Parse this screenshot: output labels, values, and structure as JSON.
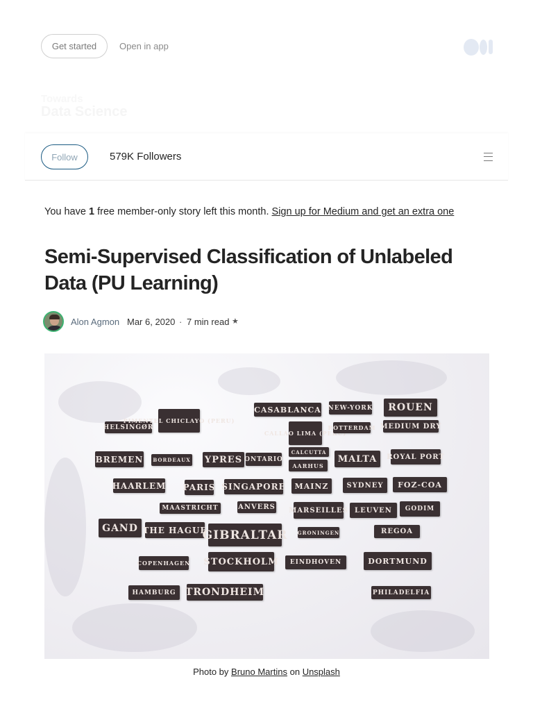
{
  "header": {
    "get_started": "Get started",
    "open_in_app": "Open in app",
    "publication_name_line1": "Towards",
    "publication_name_line2": "Data Science"
  },
  "follow_bar": {
    "follow_label": "Follow",
    "followers": "579K Followers"
  },
  "member_note": {
    "prefix": "You have",
    "count": "1",
    "middle": "free member-only story left this month.",
    "link": "Sign up for Medium and get an extra one"
  },
  "article": {
    "title": "Semi-Supervised Classification of Unlabeled Data (PU Learning)",
    "author": "Alon Agmon",
    "date": "Mar 6, 2020",
    "separator": "·",
    "read_time": "7 min read",
    "star": "★"
  },
  "photo": {
    "plates": [
      "HELSINGØR",
      "PIMENTEL CHICLAYO (PERU)",
      "CASABLANCA",
      "NEW-YORK",
      "ROUEN",
      "CALLAO LIMA (PERU)",
      "ROTTERDAM",
      "MEDIUM DRY",
      "BREMEN",
      "BORDEAUX",
      "YPRES",
      "ONTARIO",
      "CALCUTTA",
      "AARHUS",
      "MALTA",
      "ROYAL PORT",
      "HAARLEM",
      "PARIS",
      "SINGAPORE",
      "MAINZ",
      "SYDNEY",
      "FOZ-COA",
      "MAASTRICHT",
      "ANVERS",
      "MARSEILLES",
      "LEUVEN",
      "GODIM",
      "GAND",
      "THE HAGUE",
      "GIBRALTAR",
      "GRONINGEN",
      "REGOA",
      "COPENHAGEN",
      "STOCKHOLM",
      "EINDHOVEN",
      "DORTMUND",
      "HAMBURG",
      "TRONDHEIM",
      "PHILADELFIA"
    ]
  },
  "caption": {
    "prefix": "Photo by",
    "photographer": "Bruno Martins",
    "middle": "on",
    "source": "Unsplash"
  },
  "colors": {
    "follow_border": "#1a5a82",
    "author_link": "#5a6b7c",
    "avatar_ring": "#3cb371",
    "plate": "#3a3032"
  },
  "icons": [
    "medium-logo-icon",
    "menu-icon",
    "star-icon"
  ]
}
